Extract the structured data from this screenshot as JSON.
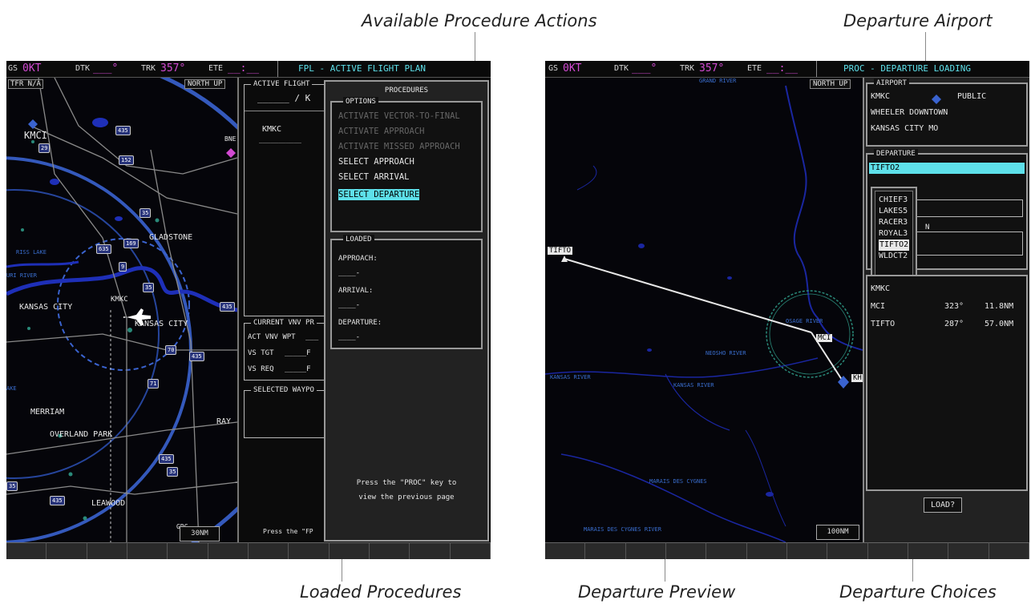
{
  "callouts": {
    "available_procedure_actions": "Available Procedure Actions",
    "departure_airport": "Departure Airport",
    "loaded_procedures": "Loaded Procedures",
    "departure_preview": "Departure Preview",
    "departure_choices": "Departure Choices"
  },
  "left_screen": {
    "topbar": {
      "gs_label": "GS",
      "gs_value": "0KT",
      "dtk_label": "DTK",
      "dtk_value": "___°",
      "trk_label": "TRK",
      "trk_value": "357°",
      "ete_label": "ETE",
      "ete_value": "__:__",
      "page_title": "FPL - ACTIVE FLIGHT PLAN"
    },
    "map": {
      "tfr_label": "TFR N/A",
      "orientation": "NORTH UP",
      "range": "30NM",
      "labels": {
        "kmci": "KMCI",
        "kmkc": "KMKC",
        "gladstone": "GLADSTONE",
        "kansas_city": "KANSAS CITY",
        "kansas_city2": "KANSAS CITY",
        "merriam": "MERRIAM",
        "overland_park": "OVERLAND PARK",
        "leawood": "LEAWOOD",
        "ray": "RAY",
        "grc": "GRC",
        "bne": "BNE",
        "riss_lake": "RISS LAKE",
        "uri_river": "URI RIVER",
        "ake": "AKE",
        "dash": "-"
      },
      "shields": [
        "435",
        "29",
        "152",
        "35",
        "169",
        "635",
        "9",
        "35",
        "70",
        "435",
        "435",
        "71",
        "35",
        "435",
        "35",
        "435"
      ]
    },
    "active_fpl": {
      "title": "ACTIVE FLIGHT",
      "route": "______ / K",
      "airport": "KMKC",
      "dashes": "___________"
    },
    "vnv": {
      "title": "CURRENT VNV PR",
      "act_vnv_wpt": "ACT VNV WPT",
      "act_vnv_val": "___",
      "vs_tgt": "VS TGT",
      "vs_tgt_val": "_____F",
      "vs_req": "VS REQ",
      "vs_req_val": "_____F"
    },
    "selected_waypoint": {
      "title": "SELECTED WAYPO"
    },
    "footer_hint": "Press the \"FP",
    "procedures": {
      "title": "PROCEDURES",
      "options_title": "OPTIONS",
      "options": [
        {
          "label": "ACTIVATE VECTOR-TO-FINAL",
          "enabled": false,
          "selected": false
        },
        {
          "label": "ACTIVATE APPROACH",
          "enabled": false,
          "selected": false
        },
        {
          "label": "ACTIVATE MISSED APPROACH",
          "enabled": false,
          "selected": false
        },
        {
          "label": "SELECT APPROACH",
          "enabled": true,
          "selected": false
        },
        {
          "label": "SELECT ARRIVAL",
          "enabled": true,
          "selected": false
        },
        {
          "label": "SELECT DEPARTURE",
          "enabled": true,
          "selected": true
        }
      ],
      "loaded_title": "LOADED",
      "approach_label": "APPROACH:",
      "approach_value": "____-",
      "arrival_label": "ARRIVAL:",
      "arrival_value": "____-",
      "departure_label": "DEPARTURE:",
      "departure_value": "____-",
      "hint_line1": "Press the \"PROC\" key to",
      "hint_line2": "view the previous page"
    }
  },
  "right_screen": {
    "topbar": {
      "gs_label": "GS",
      "gs_value": "0KT",
      "dtk_label": "DTK",
      "dtk_value": "___°",
      "trk_label": "TRK",
      "trk_value": "357°",
      "ete_label": "ETE",
      "ete_value": "__:__",
      "page_title": "PROC - DEPARTURE LOADING"
    },
    "map": {
      "orientation": "NORTH UP",
      "range": "100NM",
      "tifto_label": "TIFTO",
      "mci_label": "MCI",
      "kh_label": "KH",
      "river_labels": [
        "KANSAS RIVER",
        "KANSAS RIVER",
        "MARAIS DES CYGNES",
        "MARAIS DES CYGNES RIVER",
        "OSAGE RIVER",
        "NEOSHO RIVER",
        "GRAND RIVER"
      ]
    },
    "airport": {
      "title": "AIRPORT",
      "ident": "KMKC",
      "type": "PUBLIC",
      "name": "WHEELER DOWNTOWN",
      "city": "KANSAS CITY MO"
    },
    "departure": {
      "title": "DEPARTURE",
      "selected": "TIFTO2",
      "choices": [
        "CHIEF3",
        "LAKES5",
        "RACER3",
        "ROYAL3",
        "TIFTO2",
        "WLDCT2"
      ],
      "selected_index": 4,
      "partial_n": "N"
    },
    "sequence": [
      {
        "wpt": "KMKC",
        "dtk": "",
        "dis": ""
      },
      {
        "wpt": "MCI",
        "dtk": "323°",
        "dis": "11.8NM"
      },
      {
        "wpt": "TIFTO",
        "dtk": "287°",
        "dis": "57.0NM"
      }
    ],
    "load_button": "LOAD?"
  },
  "colors": {
    "cyan": "#5ee0ea",
    "magenta": "#d24ad2",
    "bezel": "#9a9a9a",
    "screen_bg": "#0b0b0e",
    "water": "#1e2fb8",
    "airspace": "#3a63cf"
  }
}
